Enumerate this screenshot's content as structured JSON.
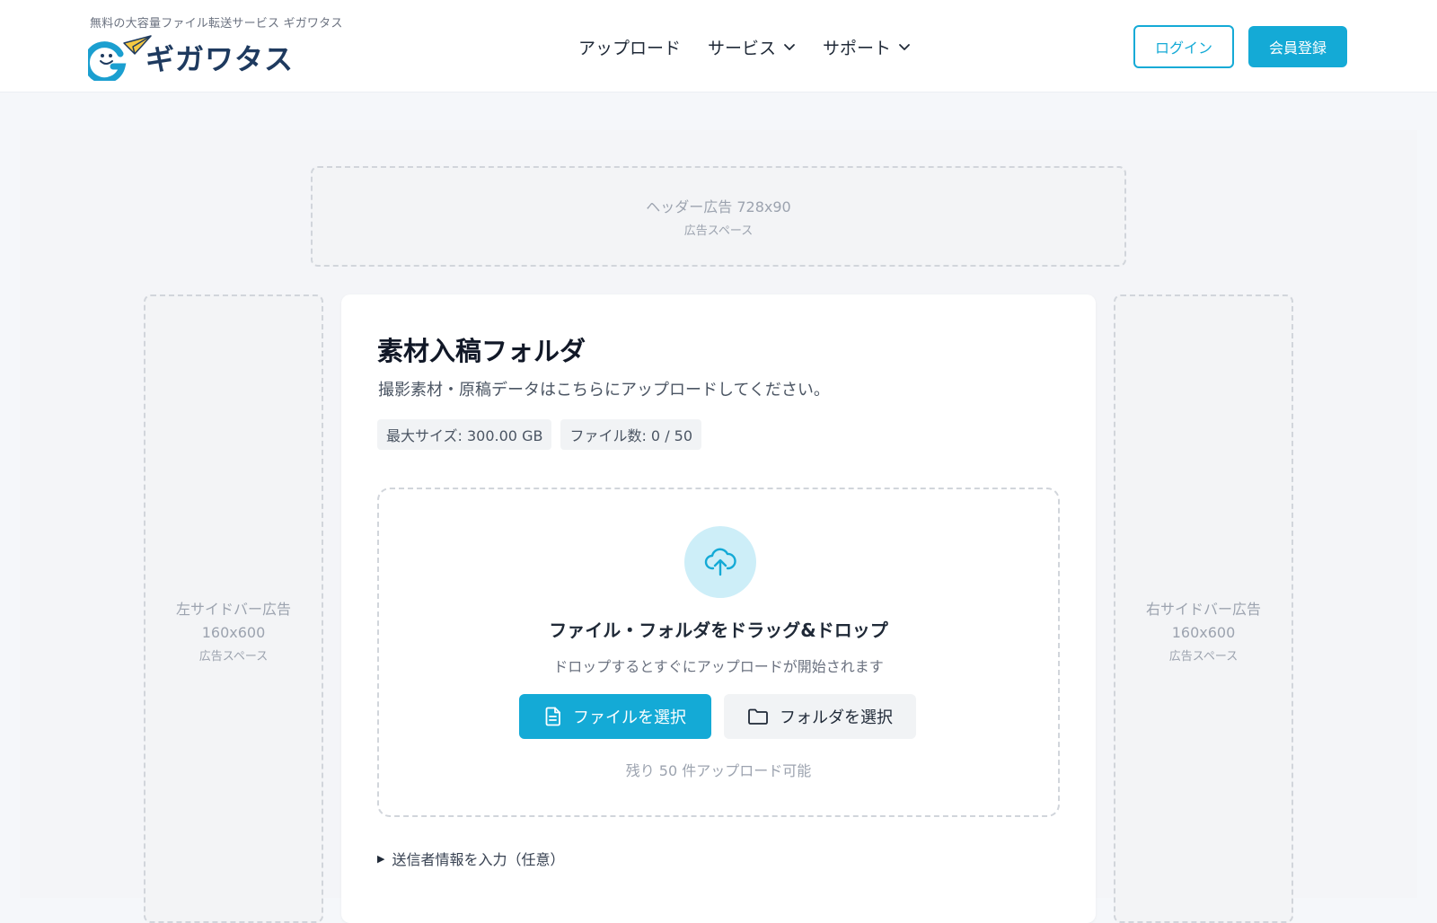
{
  "header": {
    "tagline": "無料の大容量ファイル転送サービス ギガワタス",
    "logo_text": "ギガワタス",
    "nav": [
      {
        "label": "アップロード",
        "has_dropdown": false
      },
      {
        "label": "サービス",
        "has_dropdown": true
      },
      {
        "label": "サポート",
        "has_dropdown": true
      }
    ],
    "login_label": "ログイン",
    "register_label": "会員登録"
  },
  "ads": {
    "header": {
      "title": "ヘッダー広告 728x90",
      "sub": "広告スペース"
    },
    "left": {
      "title_line1": "左サイドバー広告",
      "title_line2": "160x600",
      "sub": "広告スペース"
    },
    "right": {
      "title_line1": "右サイドバー広告",
      "title_line2": "160x600",
      "sub": "広告スペース"
    }
  },
  "folder": {
    "title": "素材入稿フォルダ",
    "description": "撮影素材・原稿データはこちらにアップロードしてください。",
    "max_size": "最大サイズ: 300.00 GB",
    "file_count": "ファイル数: 0 / 50"
  },
  "dropzone": {
    "icon": "cloud-upload-icon",
    "title": "ファイル・フォルダをドラッグ&ドロップ",
    "subtitle": "ドロップするとすぐにアップロードが開始されます",
    "select_file_label": "ファイルを選択",
    "select_folder_label": "フォルダを選択",
    "remaining": "残り 50 件アップロード可能"
  },
  "sender": {
    "toggle_label": "送信者情報を入力（任意）"
  },
  "colors": {
    "accent": "#14aad6",
    "logo_text": "#1e3a5f",
    "upload_circle": "#cdeef8"
  }
}
